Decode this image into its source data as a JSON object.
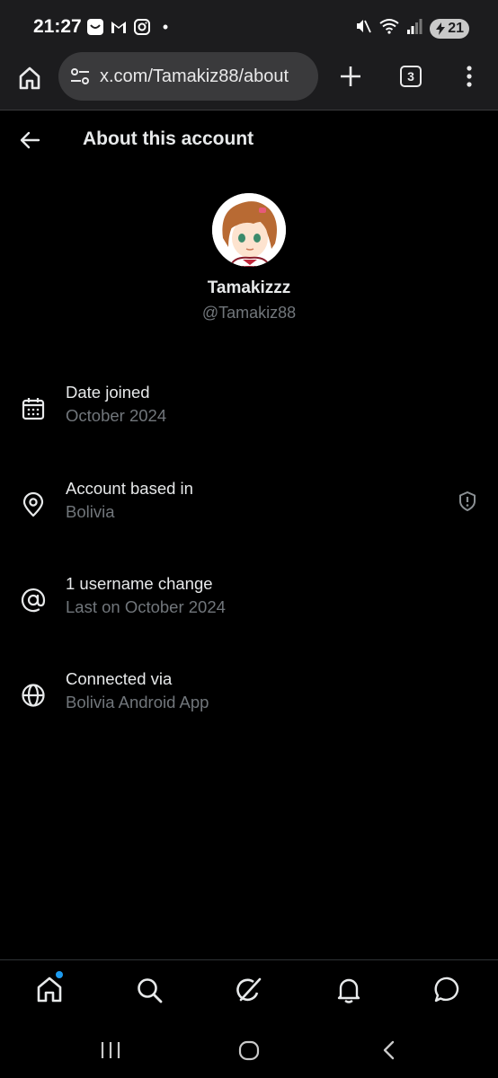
{
  "status_bar": {
    "time": "21:27",
    "notification_icons": [
      "smiley-app-icon",
      "gmail-icon",
      "instagram-icon"
    ],
    "more_dot": "•",
    "battery_level": "21",
    "right_icons": [
      "mute-icon",
      "wifi-icon",
      "signal-icon",
      "battery-icon"
    ]
  },
  "browser": {
    "url": "x.com/Tamakiz88/about",
    "tab_count": "3"
  },
  "header": {
    "title": "About this account"
  },
  "profile": {
    "display_name": "Tamakizzz",
    "handle": "@Tamakiz88"
  },
  "info_rows": [
    {
      "icon": "calendar-icon",
      "label": "Date joined",
      "value": "October 2024"
    },
    {
      "icon": "location-pin-icon",
      "label": "Account based in",
      "value": "Bolivia",
      "extra_icon": "shield-alert-icon"
    },
    {
      "icon": "at-sign-icon",
      "label": "1 username change",
      "value": "Last on October 2024"
    },
    {
      "icon": "globe-icon",
      "label": "Connected via",
      "value": "Bolivia Android App"
    }
  ],
  "tab_bar": {
    "tabs": [
      "home-icon",
      "search-icon",
      "grok-icon",
      "notifications-icon",
      "messages-icon"
    ],
    "home_has_badge": true
  },
  "colors": {
    "background": "#000000",
    "chrome": "#1c1c1e",
    "primary_text": "#e7e9ea",
    "secondary_text": "#71767b",
    "accent": "#1d9bf0"
  }
}
